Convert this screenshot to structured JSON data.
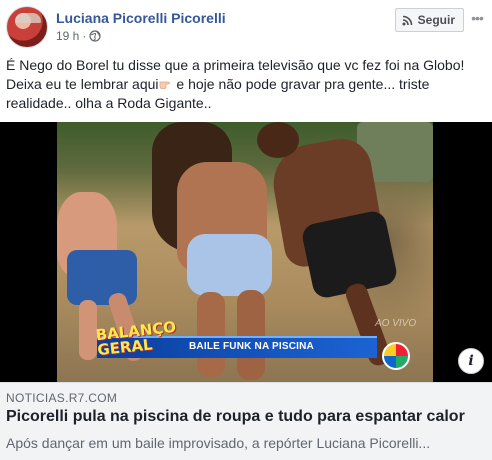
{
  "post": {
    "author": "Luciana Picorelli Picorelli",
    "timestamp": "19 h",
    "separator": "·",
    "privacy_icon": "globe-icon",
    "follow_label": "Seguir",
    "follow_icon": "rss-icon",
    "more_icon": "more-options-icon",
    "text_part1": "É Nego do Borel tu disse que a primeira televisão que vc fez foi na Globo! Deixa eu te lembrar aqui",
    "text_emoji": "pointing-hand-emoji",
    "text_part2": " e hoje não pode gravar pra gente... triste realidade.. olha a Roda Gigante.."
  },
  "media": {
    "banner_text": "BAILE FUNK NA PISCINA",
    "show_logo_line1": "BALANÇO",
    "show_logo_line2": "GERAL",
    "watermark": "AO VIVO",
    "channel_logo": "record-logo",
    "info_label": "i"
  },
  "link": {
    "domain": "NOTICIAS.R7.COM",
    "title": "Picorelli pula na piscina de roupa e tudo para espantar calor",
    "description": "Após dançar em um baile improvisado, a repórter Luciana Picorelli..."
  },
  "colors": {
    "author_link": "#365899",
    "meta_text": "#616770",
    "link_bg": "#f2f3f5",
    "banner_blue": "#1c63d3"
  }
}
